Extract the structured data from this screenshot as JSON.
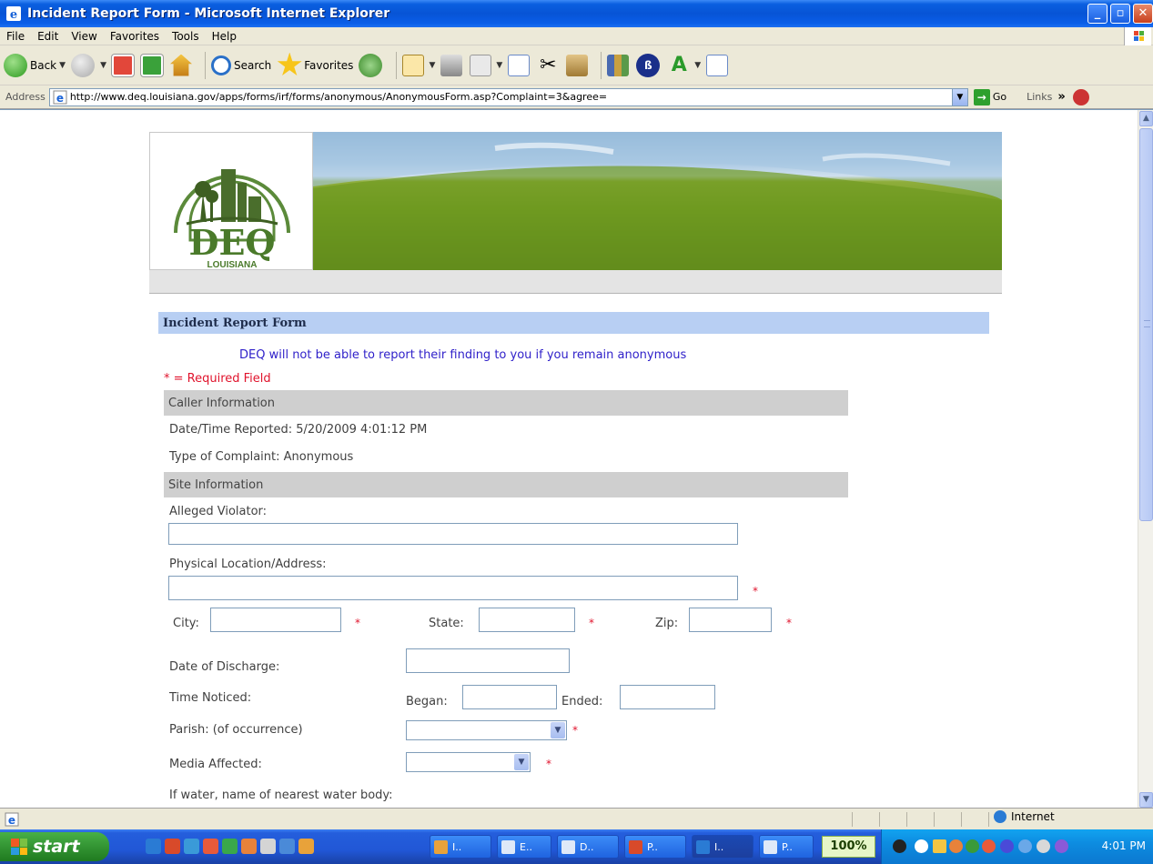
{
  "window": {
    "title": "Incident Report Form - Microsoft Internet Explorer"
  },
  "menu": [
    "File",
    "Edit",
    "View",
    "Favorites",
    "Tools",
    "Help"
  ],
  "toolbar": {
    "back_label": "Back",
    "search_label": "Search",
    "favorites_label": "Favorites"
  },
  "address": {
    "label": "Address",
    "url": "http://www.deq.louisiana.gov/apps/forms/irf/forms/anonymous/AnonymousForm.asp?Complaint=3&agree=",
    "go_label": "Go",
    "links_label": "Links"
  },
  "banner": {
    "logo_text": "DEQ",
    "logo_subtext": "LOUISIANA"
  },
  "form": {
    "header": "Incident Report Form",
    "notice": "DEQ will not be able to report their finding to you if you remain anonymous",
    "required_note": "* = Required Field",
    "caller_section": "Caller Information",
    "date_reported": "Date/Time Reported: 5/20/2009 4:01:12 PM",
    "complaint_type": "Type of Complaint: Anonymous",
    "site_section": "Site Information",
    "alleged_violator_label": "Alleged Violator:",
    "physical_location_label": "Physical Location/Address:",
    "city_label": "City:",
    "state_label": "State:",
    "zip_label": "Zip:",
    "date_discharge_label": "Date of Discharge:",
    "time_noticed_label": "Time Noticed:",
    "began_label": "Began:",
    "ended_label": "Ended:",
    "parish_label": "Parish: (of occurrence)",
    "media_label": "Media Affected:",
    "water_label": "If water, name of nearest water body:",
    "required_star": "*"
  },
  "status": {
    "zone": "Internet"
  },
  "taskbar": {
    "start_label": "start",
    "buttons": [
      "I..",
      "E..",
      "D..",
      "P..",
      "I..",
      "P.."
    ],
    "zoom": "100%",
    "clock": "4:01 PM"
  },
  "colors": {
    "title_blue": "#0754d6",
    "form_header_bg": "#b8cff3",
    "section_bg": "#cfcfcf",
    "notice_text": "#2e1fc9",
    "required_red": "#e0132c",
    "logo_green": "#4a7a2a"
  }
}
